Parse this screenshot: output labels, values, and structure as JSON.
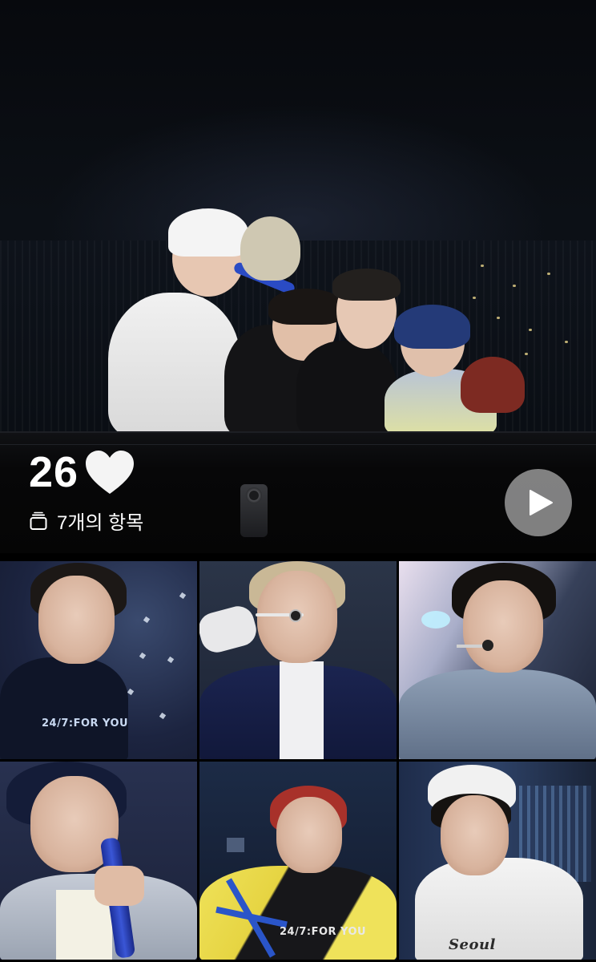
{
  "album": {
    "title": "26",
    "heart_icon": "white-heart-icon",
    "item_count_label": "7개의 항목",
    "count_icon": "photo-stack-icon",
    "play_icon": "play-icon",
    "colors": {
      "play_button_bg": "#969696",
      "text": "#ffffff",
      "background": "#000000"
    }
  },
  "cover": {
    "description_icon": "concert-stage-photo"
  },
  "thumbnails": [
    {
      "kind": "photo",
      "shirt_text": "24/7:FOR YOU"
    },
    {
      "kind": "photo",
      "shirt_text": ""
    },
    {
      "kind": "photo",
      "shirt_text": ""
    },
    {
      "kind": "photo",
      "shirt_text": ""
    },
    {
      "kind": "photo",
      "shirt_text": "24/7:FOR YOU"
    },
    {
      "kind": "photo",
      "shirt_text": "Seoul"
    }
  ]
}
